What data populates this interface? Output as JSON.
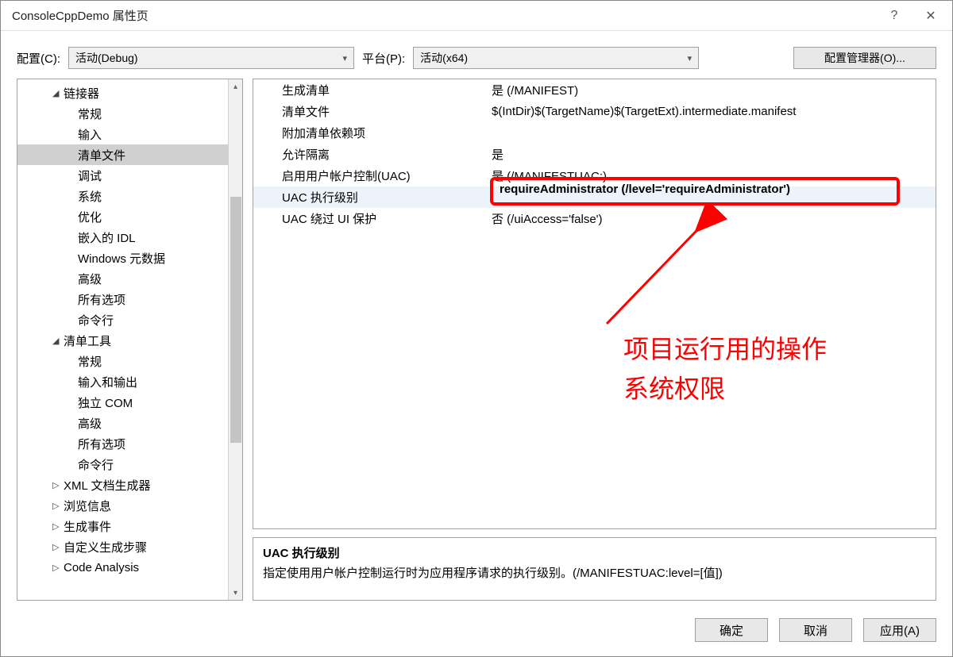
{
  "titlebar": {
    "title": "ConsoleCppDemo 属性页",
    "help": "?",
    "close": "✕"
  },
  "config": {
    "config_label": "配置(C):",
    "config_value": "活动(Debug)",
    "platform_label": "平台(P):",
    "platform_value": "活动(x64)",
    "manager_button": "配置管理器(O)..."
  },
  "tree": {
    "linker": "链接器",
    "linker_items": [
      "常规",
      "输入",
      "清单文件",
      "调试",
      "系统",
      "优化",
      "嵌入的 IDL",
      "Windows 元数据",
      "高级",
      "所有选项",
      "命令行"
    ],
    "manifest_tool": "清单工具",
    "manifest_items": [
      "常规",
      "输入和输出",
      "独立 COM",
      "高级",
      "所有选项",
      "命令行"
    ],
    "xml_doc": "XML 文档生成器",
    "browse_info": "浏览信息",
    "build_events": "生成事件",
    "custom_build": "自定义生成步骤",
    "code_analysis": "Code Analysis"
  },
  "props": [
    {
      "label": "生成清单",
      "value": "是 (/MANIFEST)"
    },
    {
      "label": "清单文件",
      "value": "$(IntDir)$(TargetName)$(TargetExt).intermediate.manifest"
    },
    {
      "label": "附加清单依赖项",
      "value": ""
    },
    {
      "label": "允许隔离",
      "value": "是"
    },
    {
      "label": "启用用户帐户控制(UAC)",
      "value": "是 (/MANIFESTUAC:)"
    },
    {
      "label": "UAC 执行级别",
      "value": ""
    },
    {
      "label": "UAC 绕过 UI 保护",
      "value": "否 (/uiAccess='false')"
    }
  ],
  "highlight_value": "requireAdministrator (/level='requireAdministrator')",
  "annotation": {
    "line1": "项目运行用的操作",
    "line2": "系统权限"
  },
  "desc": {
    "title": "UAC 执行级别",
    "text": "指定使用用户帐户控制运行时为应用程序请求的执行级别。(/MANIFESTUAC:level=[值])"
  },
  "footer": {
    "ok": "确定",
    "cancel": "取消",
    "apply": "应用(A)"
  }
}
